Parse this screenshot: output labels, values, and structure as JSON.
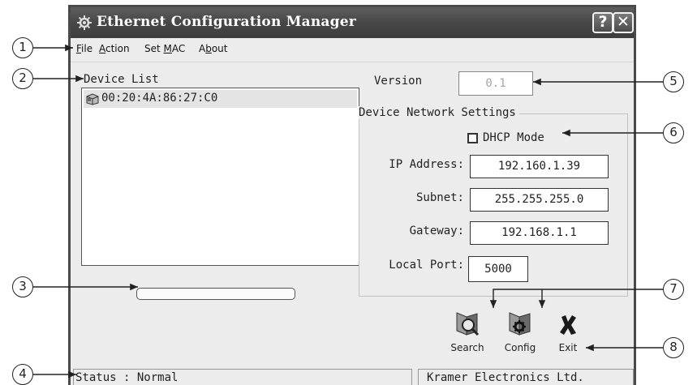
{
  "window": {
    "title": "Ethernet Configuration Manager",
    "help_button": "?",
    "close_button": "✕"
  },
  "menu": {
    "items": [
      {
        "label": "File",
        "accel": "F"
      },
      {
        "label": "Action",
        "accel": "A"
      },
      {
        "label": "Set MAC",
        "accel": "M"
      },
      {
        "label": "About",
        "accel": "b"
      }
    ]
  },
  "device_list": {
    "header": "Device List",
    "items": [
      "00:20:4A:86:27:C0"
    ]
  },
  "progress": {
    "value": 0
  },
  "version": {
    "label": "Version",
    "value": "0.1"
  },
  "network_settings": {
    "title": "Device Network Settings",
    "dhcp_label": "DHCP Mode",
    "dhcp_checked": false,
    "ip_label": "IP Address:",
    "ip_value": "192.160.1.39",
    "subnet_label": "Subnet:",
    "subnet_value": "255.255.255.0",
    "gateway_label": "Gateway:",
    "gateway_value": "192.168.1.1",
    "port_label": "Local Port:",
    "port_value": "5000"
  },
  "toolbar": {
    "search_label": "Search",
    "config_label": "Config",
    "exit_label": "Exit"
  },
  "status": {
    "left": "Status : Normal",
    "right": "Kramer Electronics Ltd."
  },
  "callouts": [
    "1",
    "2",
    "3",
    "4",
    "5",
    "6",
    "7",
    "8"
  ],
  "colors": {
    "titlebar": "#474747",
    "window_bg": "#ececec",
    "exit_icon": "#1a1a1a"
  }
}
